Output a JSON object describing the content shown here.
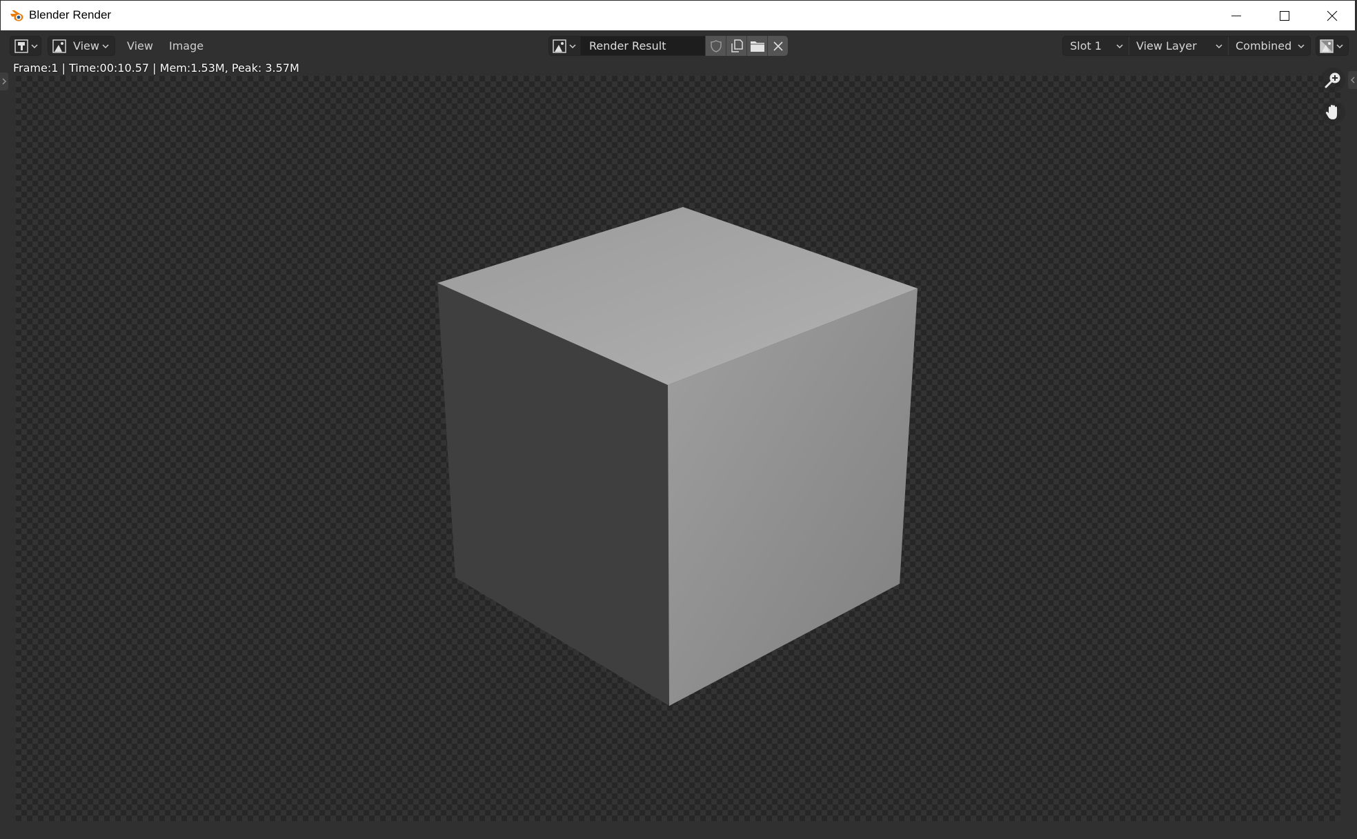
{
  "window": {
    "title": "Blender Render",
    "logo_icon": "blender-logo-icon",
    "controls": [
      "minimize-icon",
      "maximize-icon",
      "close-icon"
    ]
  },
  "header": {
    "editor_type_icon": "image-editor-icon",
    "view_mode": {
      "icon": "image-icon",
      "label": "View"
    },
    "menus": [
      {
        "label": "View"
      },
      {
        "label": "Image"
      }
    ],
    "image": {
      "browse_icon": "image-icon",
      "name": "Render Result",
      "actions": [
        {
          "icon": "fake-user-shield-icon"
        },
        {
          "icon": "duplicate-icon"
        },
        {
          "icon": "open-folder-icon"
        },
        {
          "icon": "unlink-x-icon"
        }
      ]
    },
    "slot": "Slot 1",
    "view_layer": "View Layer",
    "pass": "Combined",
    "display_icon": "display-channels-icon"
  },
  "stats": {
    "text": "Frame:1 | Time:00:10.57 | Mem:1.53M, Peak: 3.57M"
  },
  "viewport": {
    "render": "Default cube render",
    "face_colors": {
      "top_light": "#b2b2b2",
      "top_dark": "#9a9a9a",
      "left": "#3f3f3f",
      "right_light": "#a0a0a0",
      "right_dark": "#7f7f7f"
    },
    "nav_gizmos": [
      "zoom-icon",
      "pan-hand-icon"
    ]
  }
}
